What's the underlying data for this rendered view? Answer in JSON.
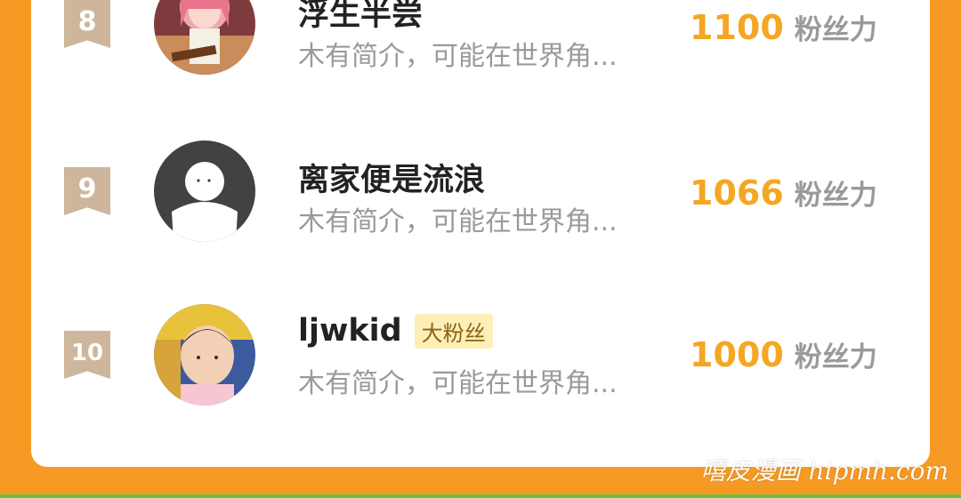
{
  "colors": {
    "background": "#F79A24",
    "card": "#FFFFFF",
    "accent_score": "#F5A623",
    "rank_badge": "#CDB69C",
    "tag_bg": "#FDEFB6"
  },
  "rows": [
    {
      "rank": "8",
      "name": "浮生半尝",
      "intro": "木有简介，可能在世界角...",
      "score": "1100",
      "score_unit": "粉丝力",
      "avatar": "anime-girl-avatar"
    },
    {
      "rank": "9",
      "name": "离家便是流浪",
      "intro": "木有简介，可能在世界角...",
      "score": "1066",
      "score_unit": "粉丝力",
      "avatar": "default-person-avatar"
    },
    {
      "rank": "10",
      "name": "ljwkid",
      "tag": "大粉丝",
      "intro": "木有简介，可能在世界角...",
      "score": "1000",
      "score_unit": "粉丝力",
      "avatar": "child-photo-avatar"
    }
  ],
  "watermark": "嘻皮漫画 hipmh.com"
}
